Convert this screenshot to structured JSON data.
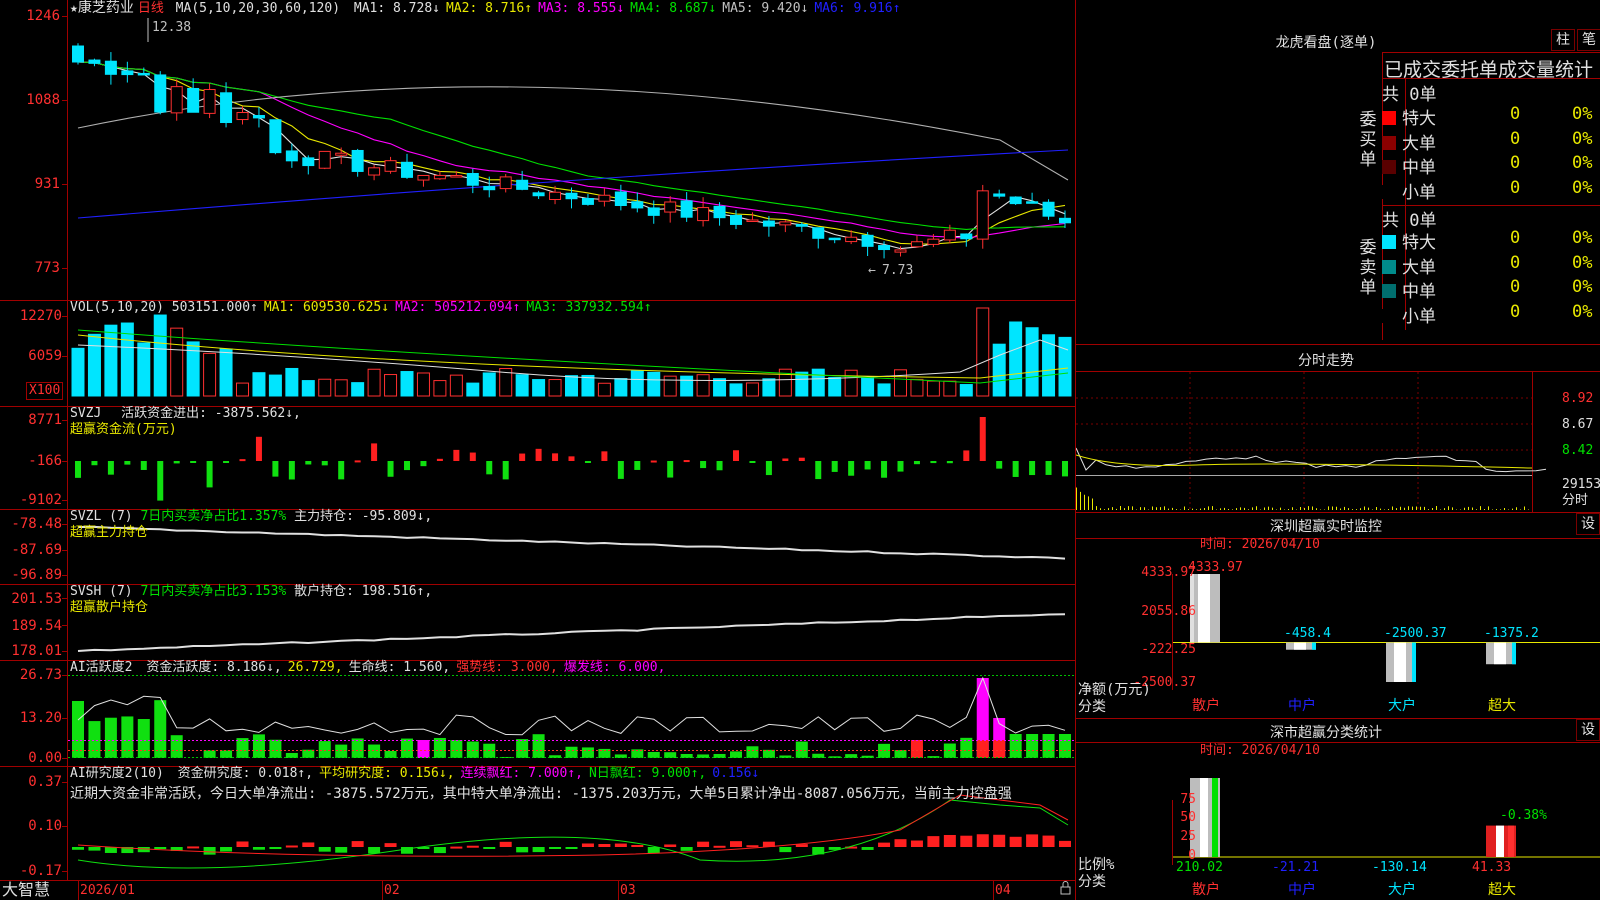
{
  "header": {
    "star": "★",
    "stock_name": "康芝药业",
    "period": "日线",
    "ma_params": "MA(5,10,20,30,60,120)",
    "ma_items": [
      {
        "text": "MA1: 8.728↓",
        "color": "#e0e0e0"
      },
      {
        "text": "MA2: 8.716↑",
        "color": "#e8e800"
      },
      {
        "text": "MA3: 8.555↓",
        "color": "#ff00ff"
      },
      {
        "text": "MA4: 8.687↓",
        "color": "#00e000"
      },
      {
        "text": "MA5: 9.420↓",
        "color": "#c0c0c0"
      },
      {
        "text": "MA6: 9.916↑",
        "color": "#2020ff"
      }
    ]
  },
  "price_axis": {
    "labels": [
      "1246",
      "1088",
      "931",
      "773"
    ]
  },
  "price_marks": {
    "high": "12.38",
    "low": "7.73"
  },
  "volume": {
    "header_name": "VOL(5,10,20)",
    "header_value": "503151.000↑",
    "items": [
      {
        "text": "MA1: 609530.625↓",
        "color": "#e8e800"
      },
      {
        "text": "MA2: 505212.094↑",
        "color": "#ff00ff"
      },
      {
        "text": "MA3: 337932.594↑",
        "color": "#00e000"
      }
    ],
    "axis": [
      "12270",
      "6059"
    ],
    "unit": "X100"
  },
  "svzj": {
    "name": "SVZJ",
    "line1": "活跃资金进出: -3875.562↓,",
    "line2": "超赢资金流(万元)",
    "axis": [
      "8771",
      "-166",
      "-9102"
    ]
  },
  "svzl": {
    "name": "SVZL (7)",
    "ratio": "7日内买卖净占比1.357%",
    "hold": "主力持仓: -95.809↓,",
    "line2": "超赢主力持仓",
    "axis": [
      "-78.48",
      "-87.69",
      "-96.89"
    ]
  },
  "svsh": {
    "name": "SVSH (7)",
    "ratio": "7日内买卖净占比3.153%",
    "hold": "散户持仓: 198.516↑,",
    "line2": "超赢散户持仓",
    "axis": [
      "201.53",
      "189.54",
      "178.01"
    ]
  },
  "ai1": {
    "name": "AI活跃度2",
    "parts": [
      {
        "text": "资金活跃度: 8.186↓,",
        "color": "#e0e0e0"
      },
      {
        "text": "26.729,",
        "color": "#e8e800"
      },
      {
        "text": "生命线: 1.560,",
        "color": "#e0e0e0"
      },
      {
        "text": "强势线: 3.000,",
        "color": "#ff3030"
      },
      {
        "text": "爆发线: 6.000,",
        "color": "#ff00ff"
      }
    ],
    "axis": [
      "26.73",
      "13.20",
      "0.00"
    ]
  },
  "ai2": {
    "name": "AI研究度2(10)",
    "parts": [
      {
        "text": "资金研究度: 0.018↑,",
        "color": "#e0e0e0"
      },
      {
        "text": "平均研究度: 0.156↓,",
        "color": "#e8e800"
      },
      {
        "text": "连续飘红: 7.000↑,",
        "color": "#ff00ff"
      },
      {
        "text": "N日飘红: 9.000↑,",
        "color": "#00e000"
      },
      {
        "text": "0.156↓",
        "color": "#2020ff"
      }
    ],
    "comment": "近期大资金非常活跃，今日大单净流出: -3875.572万元，其中特大单净流出: -1375.203万元，大单5日累计净出-8087.056万元，当前主力控盘强",
    "axis": [
      "0.37",
      "0.10",
      "-0.17"
    ]
  },
  "date_axis": {
    "labels": [
      "2026/01",
      "02",
      "03",
      "04"
    ]
  },
  "brand": "大智慧",
  "right": {
    "lhkp_title": "龙虎看盘(逐单)",
    "btn_zhu": "柱",
    "btn_bi": "笔",
    "tabs": "已成交委托单成交量统计",
    "buy": {
      "side": "委买单",
      "total": "共 0单",
      "rows": [
        {
          "label": "特大",
          "count": "0",
          "pct": "0%",
          "color": "#ff0000"
        },
        {
          "label": "大单",
          "count": "0",
          "pct": "0%",
          "color": "#8b0000"
        },
        {
          "label": "中单",
          "count": "0",
          "pct": "0%",
          "color": "#5a0000"
        },
        {
          "label": "小单",
          "count": "0",
          "pct": "0%",
          "color": "#000000"
        }
      ]
    },
    "sell": {
      "side": "委卖单",
      "total": "共 0单",
      "rows": [
        {
          "label": "特大",
          "count": "0",
          "pct": "0%",
          "color": "#00e5ff"
        },
        {
          "label": "大单",
          "count": "0",
          "pct": "0%",
          "color": "#008b8b"
        },
        {
          "label": "中单",
          "count": "0",
          "pct": "0%",
          "color": "#006e6e"
        },
        {
          "label": "小单",
          "count": "0",
          "pct": "0%",
          "color": "#000000"
        }
      ]
    },
    "fenshi": {
      "title": "分时走势",
      "axis": [
        "8.92",
        "8.67",
        "8.42",
        "29153",
        "分时"
      ]
    },
    "monitor": {
      "title": "深圳超赢实时监控",
      "btn": "设",
      "time": "时间: 2026/04/10",
      "axis": [
        "4333.97",
        "2055.86",
        "-222.25",
        "-2500.37"
      ],
      "ylabel": "净额(万元)",
      "xlabel": "分类",
      "categories": [
        "散户",
        "中户",
        "大户",
        "超大"
      ],
      "values": [
        4333.97,
        -458.4,
        -2500.37,
        -1375.2
      ],
      "value_labels": [
        "4333.97",
        "-458.4",
        "-2500.37",
        "-1375.2"
      ]
    },
    "classify": {
      "title": "深市超赢分类统计",
      "btn": "设",
      "time": "时间: 2026/04/10",
      "axis": [
        "75",
        "50",
        "25",
        "0"
      ],
      "ylabel": "比例%",
      "xlabel": "分类",
      "pct_label": "-0.38%",
      "categories": [
        "散户",
        "中户",
        "大户",
        "超大"
      ],
      "values": [
        "210.02",
        "-21.21",
        "-130.14",
        "41.33"
      ]
    }
  },
  "chart_data": [
    {
      "type": "bar",
      "title": "深圳超赢实时监控",
      "categories": [
        "散户",
        "中户",
        "大户",
        "超大"
      ],
      "values": [
        4333.97,
        -458.4,
        -2500.37,
        -1375.2
      ],
      "ylabel": "净额(万元)",
      "xlabel": "分类",
      "ylim": [
        -2500.37,
        4333.97
      ]
    },
    {
      "type": "bar",
      "title": "深市超赢分类统计",
      "categories": [
        "散户",
        "中户",
        "大户",
        "超大"
      ],
      "values": [
        210.02,
        -21.21,
        -130.14,
        41.33
      ],
      "ylabel": "比例%",
      "xlabel": "分类",
      "ylim": [
        0,
        75
      ]
    }
  ]
}
